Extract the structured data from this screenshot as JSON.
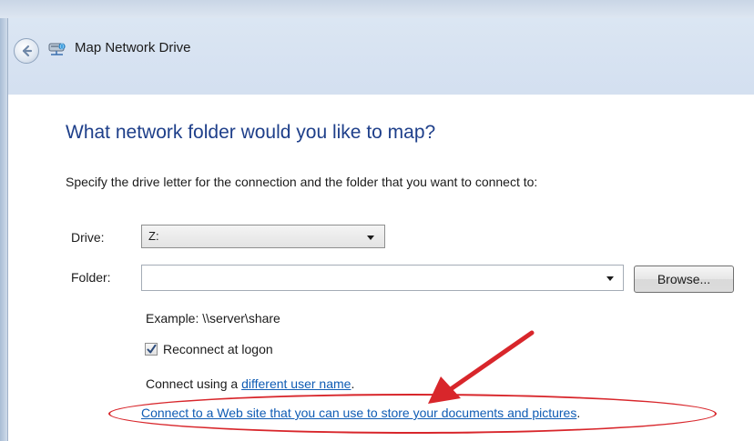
{
  "window": {
    "title": "Map Network Drive"
  },
  "dialog": {
    "heading": "What network folder would you like to map?",
    "instruction": "Specify the drive letter for the connection and the folder that you want to connect to:",
    "drive_label": "Drive:",
    "drive_value": "Z:",
    "folder_label": "Folder:",
    "folder_value": "",
    "browse_label": "Browse...",
    "example_text": "Example: \\\\server\\share",
    "reconnect_label": "Reconnect at logon",
    "reconnect_checked": true,
    "connect_prefix": "Connect using a ",
    "connect_link": "different user name",
    "connect_suffix": ".",
    "web_link": "Connect to a Web site that you can use to store your documents and pictures",
    "web_link_suffix": "."
  },
  "icons": {
    "back": "back-arrow-icon",
    "network_drive": "network-drive-icon",
    "dropdown": "chevron-down-icon",
    "check": "checkmark-icon"
  },
  "colors": {
    "heading": "#1e3f8a",
    "link": "#0f5cb4",
    "annotation": "#d8262b",
    "titlebar": "#d6e2f1"
  }
}
